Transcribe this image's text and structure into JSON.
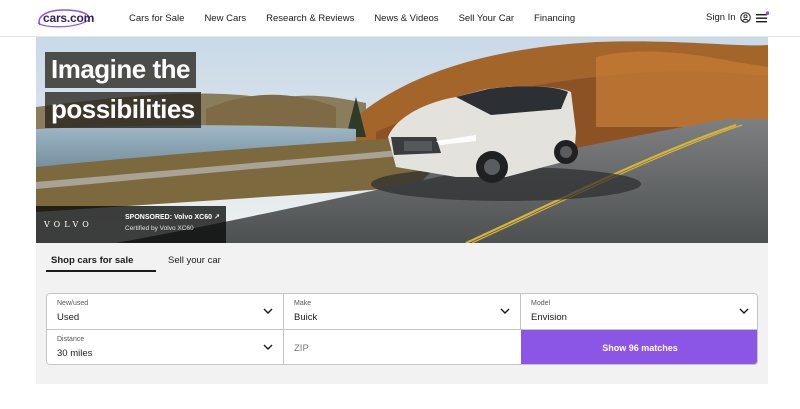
{
  "brand": {
    "logo_text": "cars.com",
    "accent": "#8b55e6",
    "logo_color": "#2f1d5c"
  },
  "nav": {
    "items": [
      {
        "label": "Cars for Sale"
      },
      {
        "label": "New Cars"
      },
      {
        "label": "Research & Reviews"
      },
      {
        "label": "News & Videos"
      },
      {
        "label": "Sell Your Car"
      },
      {
        "label": "Financing"
      }
    ],
    "signin_label": "Sign In",
    "signin_icon": "user-circle-icon",
    "menu_icon": "hamburger-menu-icon"
  },
  "hero": {
    "headline_line1": "Imagine the",
    "headline_line2": "possibilities",
    "sponsor_brand": "VOLVO",
    "sponsor_title": "SPONSORED: Volvo XC60 ↗",
    "sponsor_subtitle": "Certified by Volvo XC60"
  },
  "tabs": [
    {
      "label": "Shop cars for sale",
      "active": true
    },
    {
      "label": "Sell your car",
      "active": false
    }
  ],
  "search": {
    "new_used": {
      "label": "New/used",
      "value": "Used"
    },
    "make": {
      "label": "Make",
      "value": "Buick"
    },
    "model": {
      "label": "Model",
      "value": "Envision"
    },
    "distance": {
      "label": "Distance",
      "value": "30 miles"
    },
    "zip_placeholder": "ZIP",
    "submit_label": "Show 96 matches"
  }
}
